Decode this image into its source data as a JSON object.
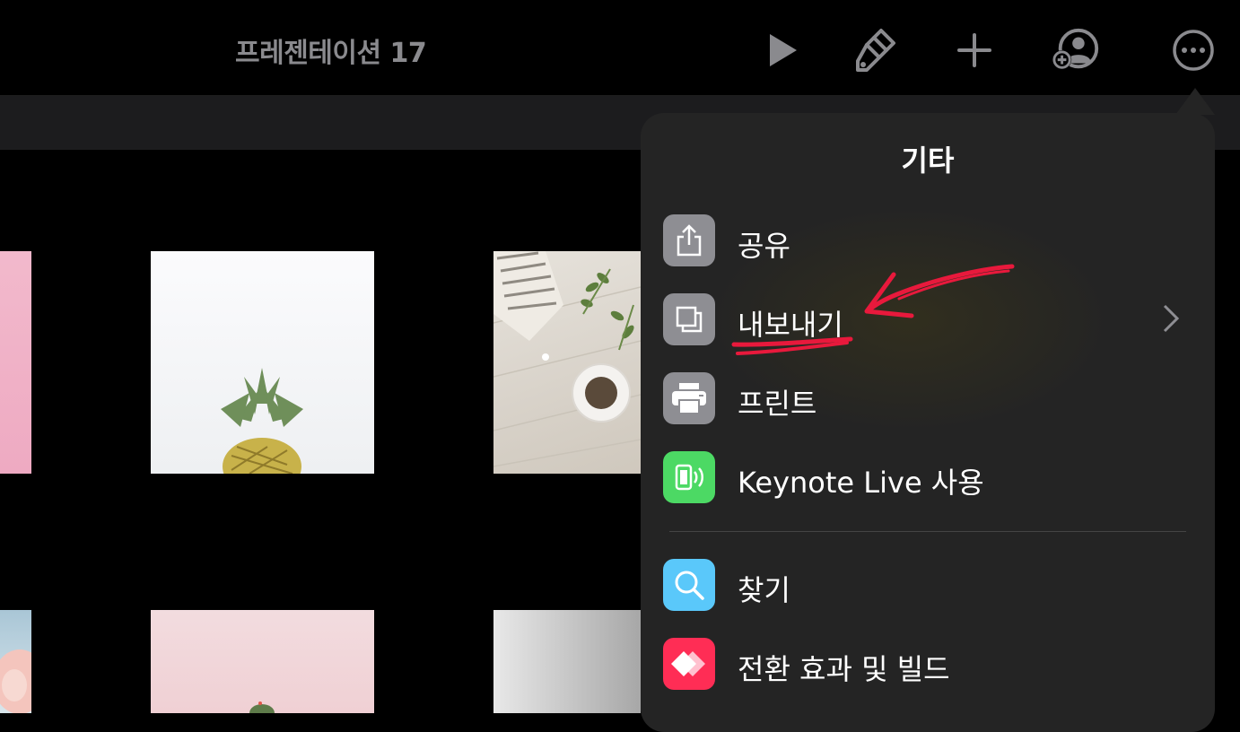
{
  "toolbar": {
    "title": "프레젠테이션 17",
    "buttons": [
      {
        "name": "play-icon"
      },
      {
        "name": "paintbrush-icon"
      },
      {
        "name": "plus-icon"
      },
      {
        "name": "collaborate-icon"
      },
      {
        "name": "more-icon"
      }
    ]
  },
  "popover": {
    "title": "기타",
    "items": [
      {
        "label": "공유",
        "icon": "share-icon",
        "icon_color": "#8e8e93"
      },
      {
        "label": "내보내기",
        "icon": "export-icon",
        "icon_color": "#8e8e93",
        "has_submenu": true
      },
      {
        "label": "프린트",
        "icon": "printer-icon",
        "icon_color": "#8e8e93"
      },
      {
        "label": "Keynote Live 사용",
        "icon": "keynote-live-icon",
        "icon_color": "#4cd964"
      },
      {
        "label": "찾기",
        "icon": "search-icon",
        "icon_color": "#5ac8fa"
      },
      {
        "label": "전환 효과 및 빌드",
        "icon": "transitions-icon",
        "icon_color": "#ff2d55"
      }
    ]
  },
  "annotation": {
    "color": "#e8193c"
  },
  "colors": {
    "background": "#000000",
    "panel": "#242424",
    "accent_red": "#e8193c"
  }
}
